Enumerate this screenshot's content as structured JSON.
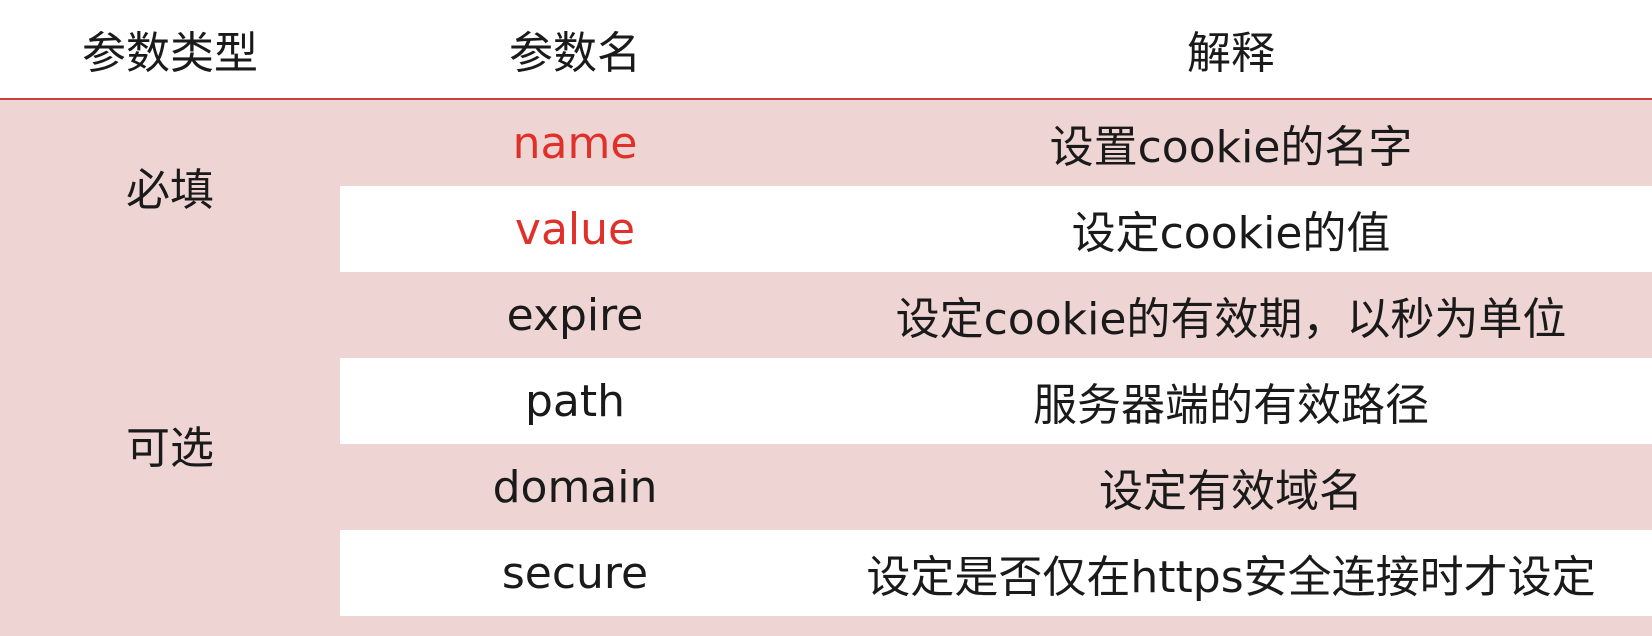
{
  "headers": {
    "type": "参数类型",
    "name": "参数名",
    "desc": "解释"
  },
  "groups": {
    "required": "必填",
    "optional": "可选"
  },
  "rows": [
    {
      "name": "name",
      "desc": "设置cookie的名字"
    },
    {
      "name": "value",
      "desc": "设定cookie的值"
    },
    {
      "name": "expire",
      "desc": "设定cookie的有效期，以秒为单位"
    },
    {
      "name": "path",
      "desc": "服务器端的有效路径"
    },
    {
      "name": "domain",
      "desc": "设定有效域名"
    },
    {
      "name": "secure",
      "desc": "设定是否仅在https安全连接时才设定"
    }
  ],
  "colors": {
    "accent_red": "#e0302a",
    "row_pink": "#eed5d3",
    "header_line": "#c9423f"
  }
}
